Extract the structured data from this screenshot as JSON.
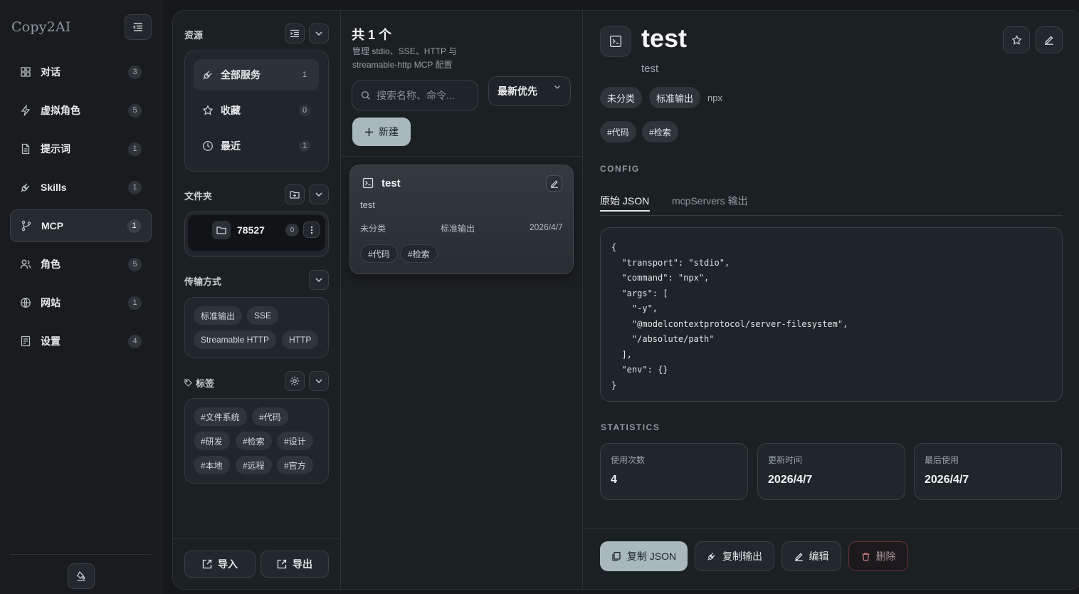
{
  "app": {
    "brand": "Copy2AI"
  },
  "nav": {
    "items": [
      {
        "label": "对话",
        "count": "3",
        "icon": "grid-icon"
      },
      {
        "label": "虚拟角色",
        "count": "5",
        "icon": "bolt-icon"
      },
      {
        "label": "提示词",
        "count": "1",
        "icon": "document-icon"
      },
      {
        "label": "Skills",
        "count": "1",
        "icon": "plug-icon"
      },
      {
        "label": "MCP",
        "count": "1",
        "icon": "branch-icon",
        "active": true
      },
      {
        "label": "角色",
        "count": "5",
        "icon": "users-icon"
      },
      {
        "label": "网站",
        "count": "1",
        "icon": "globe-icon"
      },
      {
        "label": "设置",
        "count": "4",
        "icon": "settings-icon"
      }
    ]
  },
  "resources": {
    "title": "资源",
    "items": [
      {
        "label": "全部服务",
        "count": "1",
        "icon": "plug-icon",
        "active": true
      },
      {
        "label": "收藏",
        "count": "0",
        "icon": "star-icon"
      },
      {
        "label": "最近",
        "count": "1",
        "icon": "clock-icon"
      }
    ]
  },
  "folders": {
    "title": "文件夹",
    "items": [
      {
        "name": "78527",
        "count": "0"
      }
    ]
  },
  "transport": {
    "title": "传输方式",
    "options": [
      "标准输出",
      "SSE",
      "Streamable HTTP",
      "HTTP"
    ]
  },
  "tags": {
    "title": "标签",
    "items": [
      "#文件系统",
      "#代码",
      "#研发",
      "#检索",
      "#设计",
      "#本地",
      "#远程",
      "#官方"
    ]
  },
  "footer": {
    "import": "导入",
    "export": "导出"
  },
  "list": {
    "title": "共 1 个",
    "subtitle": "管理 stdio、SSE、HTTP 与 streamable-http MCP 配置",
    "search_placeholder": "搜索名称、命令...",
    "sort": "最新优先",
    "new_button": "新建",
    "cards": [
      {
        "name": "test",
        "description": "test",
        "category": "未分类",
        "transport": "标准输出",
        "date": "2026/4/7",
        "tags": [
          "#代码",
          "#检索"
        ]
      }
    ]
  },
  "detail": {
    "title": "test",
    "subtitle": "test",
    "category": "未分类",
    "transport": "标准输出",
    "command": "npx",
    "tags": [
      "#代码",
      "#检索"
    ],
    "config_label": "CONFIG",
    "tabs": [
      "原始 JSON",
      "mcpServers 输出"
    ],
    "active_tab": 0,
    "json": "{\n  \"transport\": \"stdio\",\n  \"command\": \"npx\",\n  \"args\": [\n    \"-y\",\n    \"@modelcontextprotocol/server-filesystem\",\n    \"/absolute/path\"\n  ],\n  \"env\": {}\n}",
    "statistics_label": "STATISTICS",
    "stats": [
      {
        "label": "使用次数",
        "value": "4"
      },
      {
        "label": "更新时间",
        "value": "2026/4/7"
      },
      {
        "label": "最后使用",
        "value": "2026/4/7"
      }
    ],
    "actions": {
      "copy_json": "复制 JSON",
      "copy_output": "复制输出",
      "edit": "编辑",
      "delete": "删除"
    }
  },
  "colors": {
    "accent": "#a9b8bd",
    "danger_border": "#6a3238",
    "background": "#15191b"
  }
}
